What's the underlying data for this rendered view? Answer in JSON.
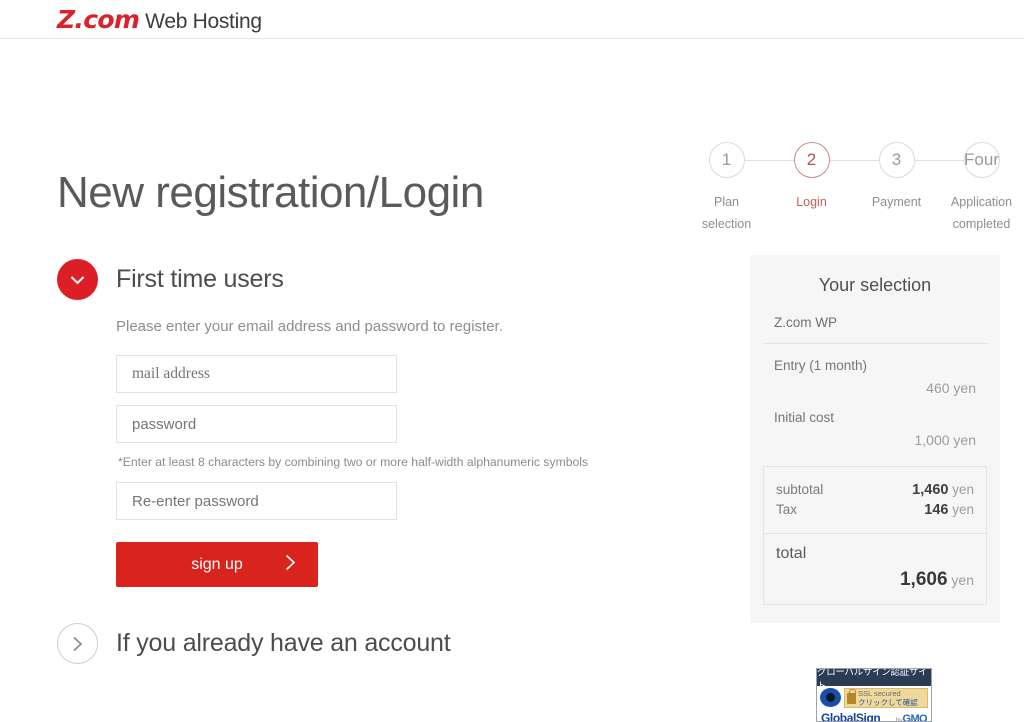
{
  "header": {
    "logo_brand": "Z.com",
    "logo_suffix": "Web Hosting"
  },
  "page_title": "New registration/Login",
  "stepper": {
    "steps": [
      {
        "number": "1",
        "label": "Plan\nselection",
        "active": false
      },
      {
        "number": "2",
        "label": "Login",
        "active": true
      },
      {
        "number": "3",
        "label": "Payment",
        "active": false
      },
      {
        "number": "Four",
        "label": "Application\ncompleted",
        "active": false
      }
    ]
  },
  "first_time_section": {
    "title": "First time users",
    "toggle_icon": "chevron-down-icon",
    "description": "Please enter your email address and password to register.",
    "fields": {
      "email_placeholder": "mail address",
      "password_placeholder": "password",
      "reenter_placeholder": "Re-enter password"
    },
    "hint": "*Enter at least 8 characters by combining two or more half-width alphanumeric symbols",
    "submit_label": "sign up"
  },
  "existing_account_section": {
    "title": "If you already have an account",
    "toggle_icon": "chevron-right-icon"
  },
  "sidebar": {
    "title": "Your selection",
    "plan_name": "Z.com WP",
    "line_items": [
      {
        "label": "Entry (1 month)",
        "amount": "460 yen"
      },
      {
        "label": "Initial cost",
        "amount": "1,000 yen"
      }
    ],
    "totals": {
      "subtotal_label": "subtotal",
      "subtotal_value": "1,460",
      "subtotal_unit": "yen",
      "tax_label": "Tax",
      "tax_value": "146",
      "tax_unit": "yen",
      "total_label": "total",
      "total_value": "1,606",
      "total_unit": "yen"
    }
  },
  "trust_badge": {
    "top_text": "グローバルサイン認証サイト",
    "ssl_en": "SSL secured",
    "ssl_jp": "クリックして確認",
    "brand": "GlobalSign",
    "by_label": "by",
    "parent_brand": "GMO"
  },
  "colors": {
    "brand_red": "#d9231d",
    "accent_red": "#dc1f26",
    "step_active": "#c0605c",
    "panel_bg": "#f6f6f6"
  }
}
